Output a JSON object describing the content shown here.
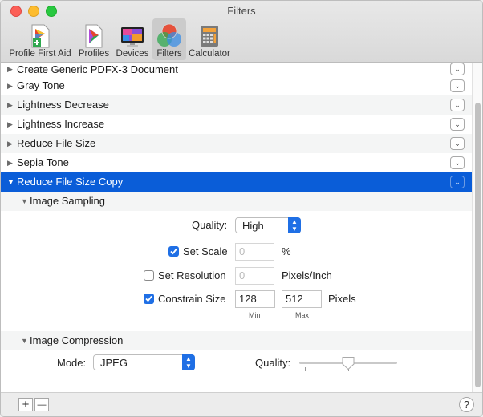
{
  "window": {
    "title": "Filters"
  },
  "toolbar": {
    "items": [
      {
        "label": "Profile First Aid",
        "icon": "profile-first-aid-icon"
      },
      {
        "label": "Profiles",
        "icon": "profiles-icon"
      },
      {
        "label": "Devices",
        "icon": "devices-icon"
      },
      {
        "label": "Filters",
        "icon": "filters-icon",
        "selected": true
      },
      {
        "label": "Calculator",
        "icon": "calculator-icon"
      }
    ]
  },
  "filters": {
    "items": [
      {
        "label": "Create Generic PDFX-3 Document"
      },
      {
        "label": "Gray Tone"
      },
      {
        "label": "Lightness Decrease"
      },
      {
        "label": "Lightness Increase"
      },
      {
        "label": "Reduce File Size"
      },
      {
        "label": "Sepia Tone"
      },
      {
        "label": "Reduce File Size Copy",
        "selected": true
      }
    ],
    "menu_glyph": "⌄"
  },
  "image_sampling": {
    "title": "Image Sampling",
    "quality_label": "Quality:",
    "quality_value": "High",
    "set_scale": {
      "label": "Set Scale",
      "checked": true,
      "value": "0",
      "unit": "%"
    },
    "set_resolution": {
      "label": "Set Resolution",
      "checked": false,
      "value": "0",
      "unit": "Pixels/Inch"
    },
    "constrain_size": {
      "label": "Constrain Size",
      "checked": true,
      "min_value": "128",
      "max_value": "512",
      "unit": "Pixels",
      "min_caption": "Min",
      "max_caption": "Max"
    }
  },
  "image_compression": {
    "title": "Image Compression",
    "mode_label": "Mode:",
    "mode_value": "JPEG",
    "quality_label": "Quality:",
    "quality_level": 0.5
  },
  "bottom_bar": {
    "add": "+",
    "remove": "—",
    "help": "?"
  },
  "colors": {
    "selection": "#0a5dd8",
    "accent": "#1f6fe5"
  }
}
